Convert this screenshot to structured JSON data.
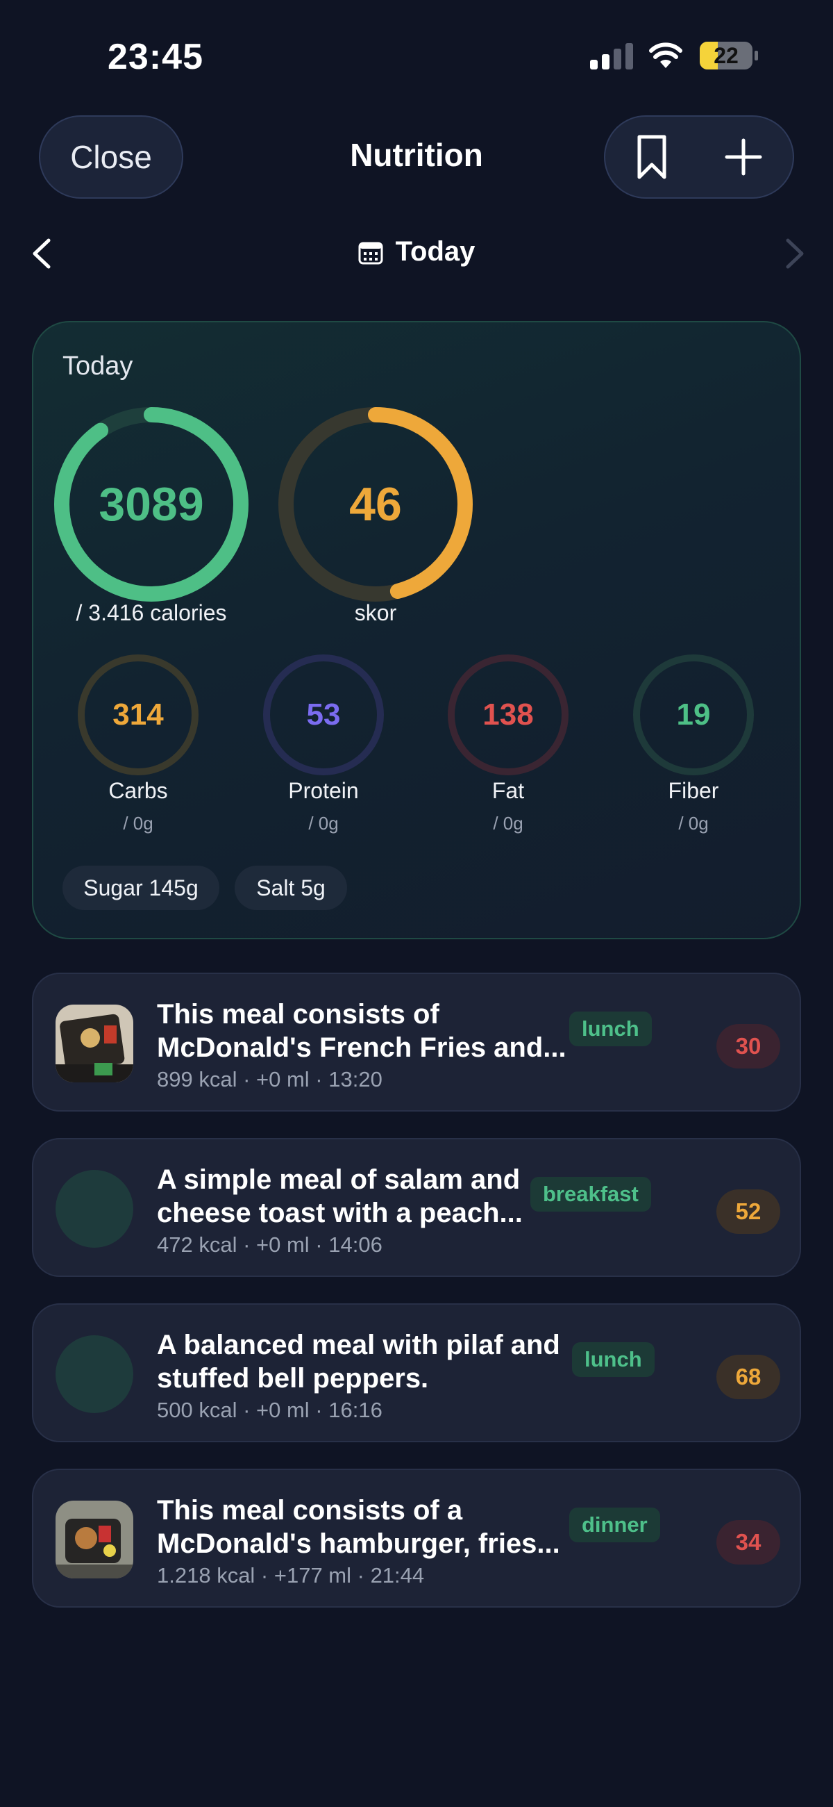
{
  "status_bar": {
    "time": "23:45",
    "battery": "22"
  },
  "header": {
    "close_label": "Close",
    "title": "Nutrition"
  },
  "date_nav": {
    "label": "Today"
  },
  "summary": {
    "title": "Today",
    "calories": {
      "value": "3089",
      "caption": "/ 3.416 calories",
      "progress": 0.904,
      "color": "#4ebf86"
    },
    "score": {
      "value": "46",
      "caption": "skor",
      "progress": 0.46,
      "color": "#eea83a"
    },
    "macros": [
      {
        "value": "314",
        "label": "Carbs",
        "sub": "/ 0g",
        "color": "#eea83a"
      },
      {
        "value": "53",
        "label": "Protein",
        "sub": "/ 0g",
        "color": "#7b6cf0"
      },
      {
        "value": "138",
        "label": "Fat",
        "sub": "/ 0g",
        "color": "#e0524f"
      },
      {
        "value": "19",
        "label": "Fiber",
        "sub": "/ 0g",
        "color": "#4ebf86"
      }
    ],
    "chips": [
      "Sugar 145g",
      "Salt 5g"
    ]
  },
  "meals": [
    {
      "title": "This meal consists of McDonald's French Fries and...",
      "meta": "899 kcal · +0 ml · 13:20",
      "tag": "lunch",
      "score": "30",
      "score_color": "red",
      "thumb": "photo"
    },
    {
      "title": "A simple meal of salam and cheese toast with a peach...",
      "meta": "472 kcal · +0 ml · 14:06",
      "tag": "breakfast",
      "score": "52",
      "score_color": "orange",
      "thumb": "placeholder"
    },
    {
      "title": "A balanced meal with pilaf and stuffed bell peppers.",
      "meta": "500 kcal · +0 ml · 16:16",
      "tag": "lunch",
      "score": "68",
      "score_color": "orange",
      "thumb": "placeholder"
    },
    {
      "title": "This meal consists of a McDonald's hamburger, fries...",
      "meta": "1.218 kcal · +177 ml · 21:44",
      "tag": "dinner",
      "score": "34",
      "score_color": "red",
      "thumb": "photo"
    }
  ]
}
